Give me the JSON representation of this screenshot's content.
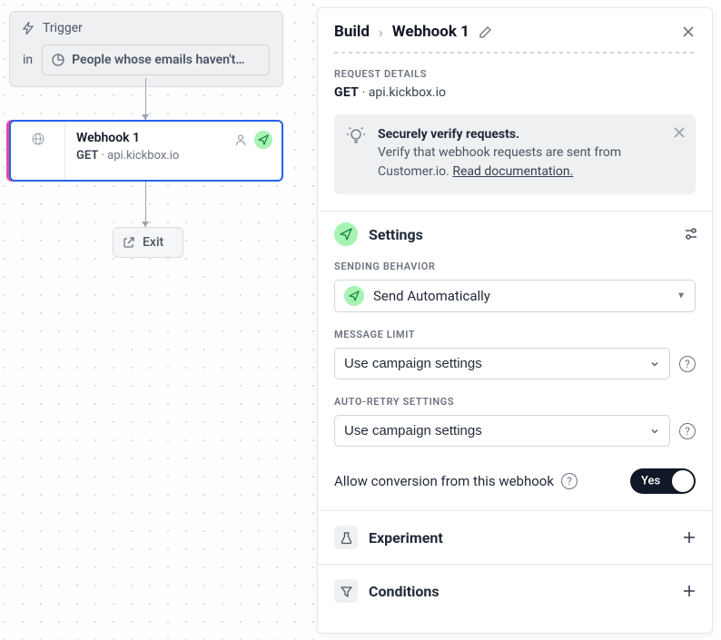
{
  "canvas": {
    "trigger": {
      "label": "Trigger",
      "in_label": "in",
      "filter_label": "People whose emails haven't…"
    },
    "webhook": {
      "title": "Webhook 1",
      "method": "GET",
      "host": "api.kickbox.io"
    },
    "exit": {
      "label": "Exit"
    }
  },
  "breadcrumb": {
    "root": "Build",
    "current": "Webhook 1"
  },
  "request_details": {
    "heading": "Request Details",
    "method": "GET",
    "host": "api.kickbox.io",
    "separator": " · "
  },
  "banner": {
    "title": "Securely verify requests.",
    "body_prefix": "Verify that webhook requests are sent from Customer.io. ",
    "link_text": "Read documentation."
  },
  "settings": {
    "heading": "Settings",
    "sending_behavior": {
      "label": "Sending Behavior",
      "value": "Send Automatically"
    },
    "message_limit": {
      "label": "Message Limit",
      "placeholder": "Use campaign settings"
    },
    "auto_retry": {
      "label": "Auto-Retry Settings",
      "placeholder": "Use campaign settings"
    },
    "conversion": {
      "label": "Allow conversion from this webhook",
      "value": "Yes"
    }
  },
  "experiment": {
    "heading": "Experiment"
  },
  "conditions": {
    "heading": "Conditions"
  }
}
